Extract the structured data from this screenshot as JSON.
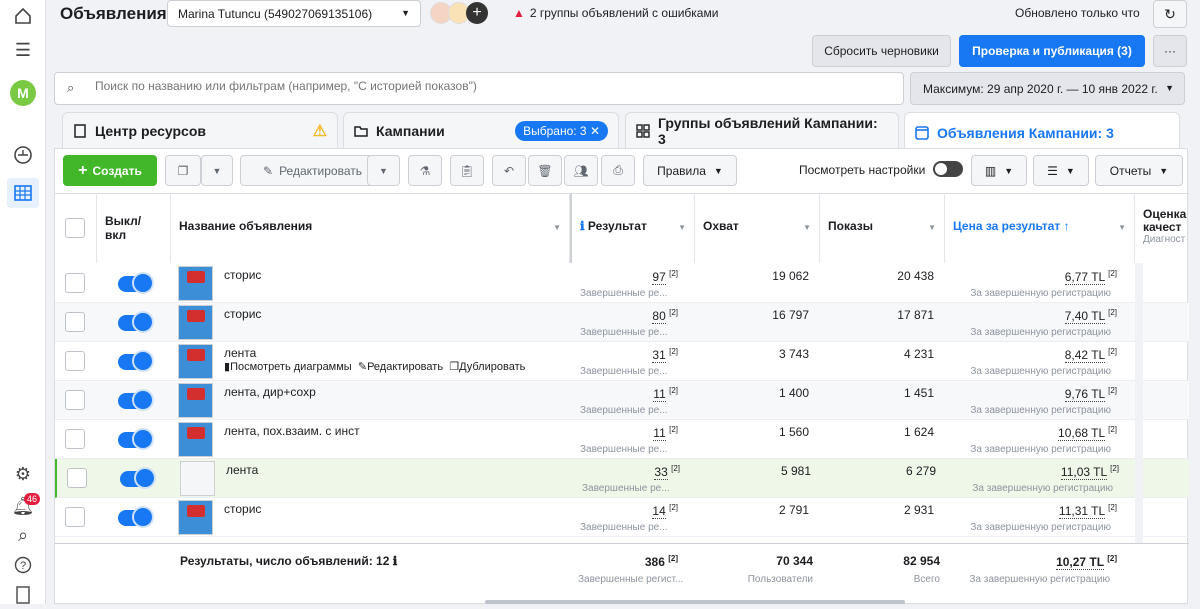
{
  "rail": {
    "avatar_letter": "M",
    "notifications_badge": "46"
  },
  "header": {
    "title": "Объявления",
    "account": "Marina Tutuncu (549027069135106)",
    "error_text": "2 группы объявлений с ошибками",
    "updated_text": "Обновлено только что",
    "discard_label": "Сбросить черновики",
    "publish_label": "Проверка и публикация (3)",
    "more_label": "···"
  },
  "search": {
    "placeholder": "Поиск по названию или фильтрам (например, \"С историей показов\")"
  },
  "date_range": "Максимум: 29 апр 2020 г. — 10 янв 2022 г.",
  "tabs": [
    {
      "label": "Центр ресурсов"
    },
    {
      "label": "Кампании",
      "pill": "Выбрано: 3"
    },
    {
      "label": "Группы объявлений Кампании: 3"
    },
    {
      "label": "Объявления Кампании: 3"
    }
  ],
  "toolbar": {
    "create": "Создать",
    "edit": "Редактировать",
    "rules": "Правила",
    "view_settings": "Посмотреть настройки",
    "reports": "Отчеты"
  },
  "columns": {
    "toggle": "Выкл/ вкл",
    "name": "Название объявления",
    "result": "Результат",
    "reach": "Охват",
    "impressions": "Показы",
    "cost": "Цена за результат",
    "quality": "Оценка качест",
    "quality_sub": "Диагност"
  },
  "row_actions": {
    "charts": "Посмотреть диаграммы",
    "edit": "Редактировать",
    "duplicate": "Дублировать"
  },
  "rows": [
    {
      "name": "сторис",
      "result": "97",
      "result_sub": "Завершенные ре...",
      "reach": "19 062",
      "impressions": "20 438",
      "cost": "6,77 TL",
      "cost_sub": "За завершенную регистрацию"
    },
    {
      "name": "сторис",
      "result": "80",
      "result_sub": "Завершенные ре...",
      "reach": "16 797",
      "impressions": "17 871",
      "cost": "7,40 TL",
      "cost_sub": "За завершенную регистрацию"
    },
    {
      "name": "лента",
      "result": "31",
      "result_sub": "Завершенные ре...",
      "reach": "3 743",
      "impressions": "4 231",
      "cost": "8,42 TL",
      "cost_sub": "За завершенную регистрацию"
    },
    {
      "name": "лента, дир+сохр",
      "result": "11",
      "result_sub": "Завершенные ре...",
      "reach": "1 400",
      "impressions": "1 451",
      "cost": "9,76 TL",
      "cost_sub": "За завершенную регистрацию"
    },
    {
      "name": "лента, пох.взаим. с инст",
      "result": "11",
      "result_sub": "Завершенные ре...",
      "reach": "1 560",
      "impressions": "1 624",
      "cost": "10,68 TL",
      "cost_sub": "За завершенную регистрацию"
    },
    {
      "name": "лента",
      "result": "33",
      "result_sub": "Завершенные ре...",
      "reach": "5 981",
      "impressions": "6 279",
      "cost": "11,03 TL",
      "cost_sub": "За завершенную регистрацию"
    },
    {
      "name": "сторис",
      "result": "14",
      "result_sub": "Завершенные ре...",
      "reach": "2 791",
      "impressions": "2 931",
      "cost": "11,31 TL",
      "cost_sub": "За завершенную регистрацию"
    }
  ],
  "footnote": "[2]",
  "totals": {
    "label": "Результаты, число объявлений: 12",
    "result": "386",
    "result_sub": "Завершенные регист...",
    "reach": "70 344",
    "reach_sub": "Пользователи",
    "impressions": "82 954",
    "impressions_sub": "Всего",
    "cost": "10,27 TL",
    "cost_sub": "За завершенную регистрацию"
  }
}
